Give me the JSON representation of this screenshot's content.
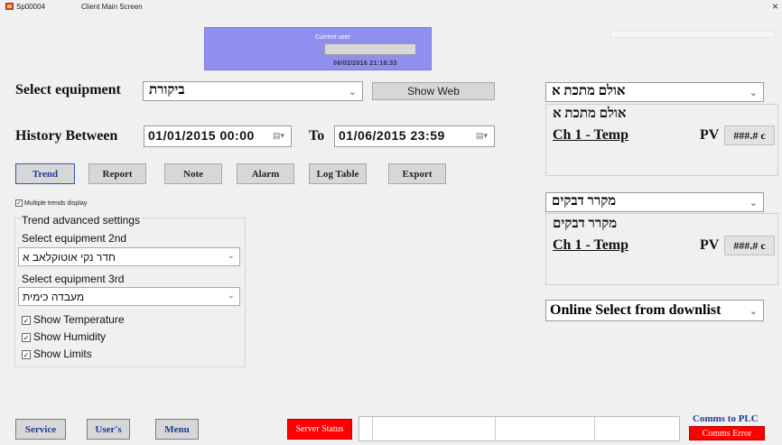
{
  "window": {
    "app_id": "Sp00004",
    "title": "Client Main Screen",
    "close_glyph": "×"
  },
  "user_panel": {
    "label": "Current user",
    "username": "",
    "datetime": "06/02/2016 21:18:33",
    "color": "#8f8ff0"
  },
  "equipment": {
    "label": "Select equipment",
    "selected": "ביקורת",
    "show_web_label": "Show Web"
  },
  "history": {
    "label": "History Between",
    "from": "01/01/2015  00:00",
    "to_label": "To",
    "to": "01/06/2015  23:59"
  },
  "actions": {
    "trend": "Trend",
    "report": "Report",
    "note": "Note",
    "alarm": "Alarm",
    "log_table": "Log Table",
    "export": "Export"
  },
  "multiple_trends": {
    "label": "Multiple trends display",
    "checked": true
  },
  "trend_advanced": {
    "title": "Trend advanced settings",
    "equip2_label": "Select equipment 2nd",
    "equip2_value": "חדר נקי אוטוקלאב א",
    "equip3_label": "Select equipment 3rd",
    "equip3_value": "מעבדה כימית",
    "show_temperature": "Show Temperature",
    "show_humidity": "Show Humidity",
    "show_limits": "Show Limits"
  },
  "online1": {
    "select_value": "אולם מתכת א",
    "title": "אולם מתכת א",
    "channel": "Ch 1 - Temp",
    "pv_label": "PV",
    "pv_value": "###.# c"
  },
  "online2": {
    "select_value": "מקרר דבקים",
    "title": "מקרר דבקים",
    "channel": "Ch 1 - Temp",
    "pv_label": "PV",
    "pv_value": "###.# c"
  },
  "online_select": {
    "value": "Online Select from downlist"
  },
  "footer": {
    "service": "Service",
    "users": "User's",
    "menu": "Menu",
    "server_status": "Server Status",
    "comms_label": "Comms to PLC",
    "comms_status": "Comms Error"
  },
  "colors": {
    "alert_red": "#ff0000",
    "button_text_blue": "#1f3a93",
    "comms_label_blue": "#1f3a93"
  }
}
